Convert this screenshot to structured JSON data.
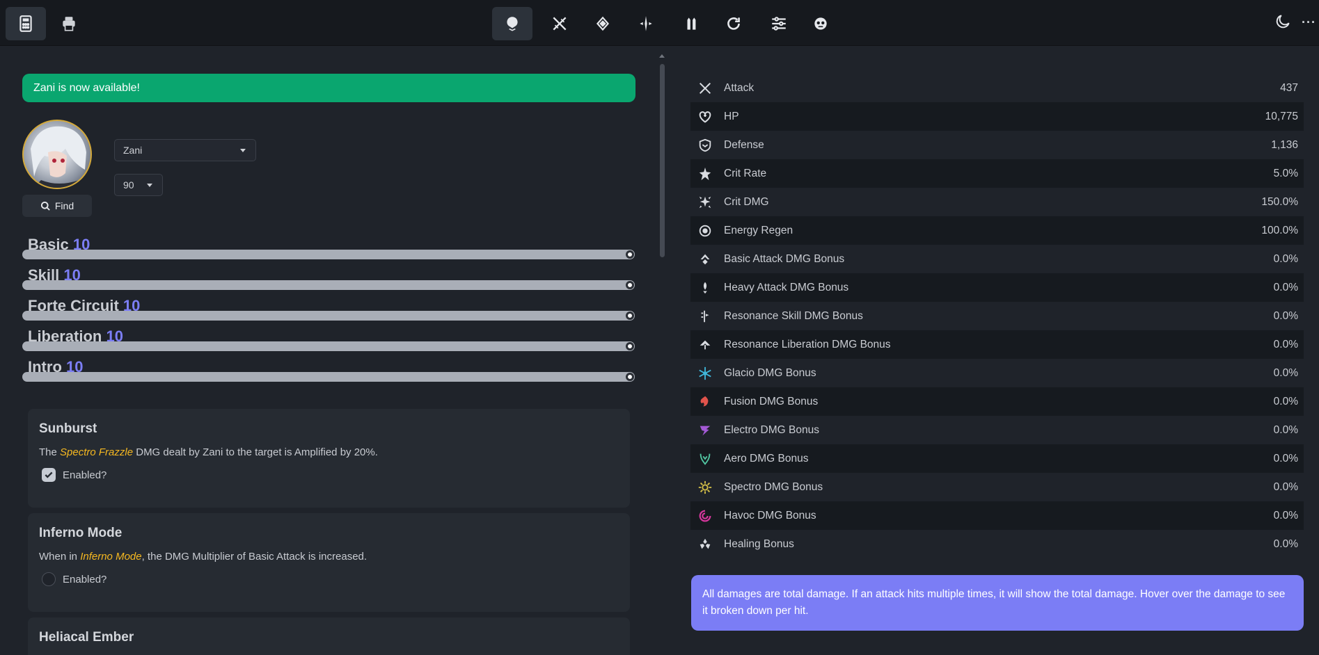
{
  "topbar": {
    "left_icons": [
      "calculator-icon",
      "printer-icon"
    ],
    "nav_icons": [
      "character-icon",
      "weapon-icon",
      "echo-icon",
      "sequence-icon",
      "team-icon",
      "rotation-icon",
      "settings-icon",
      "enemy-icon"
    ],
    "active_nav": "character-icon",
    "right_icons": [
      "moon-icon",
      "more-icon"
    ],
    "more_label": "···"
  },
  "banner": {
    "text": "Zani is now available!",
    "color": "#0aa66f"
  },
  "character": {
    "name": "Zani",
    "level": "90",
    "find_label": "Find"
  },
  "skills": [
    {
      "label": "Basic",
      "value": "10"
    },
    {
      "label": "Skill",
      "value": "10"
    },
    {
      "label": "Forte Circuit",
      "value": "10"
    },
    {
      "label": "Liberation",
      "value": "10"
    },
    {
      "label": "Intro",
      "value": "10"
    }
  ],
  "effects": [
    {
      "title": "Sunburst",
      "desc_pre": "The ",
      "desc_hl": "Spectro Frazzle",
      "desc_post": " DMG dealt by Zani to the target is Amplified by 20%.",
      "enabled_label": "Enabled?",
      "enabled": true
    },
    {
      "title": "Inferno Mode",
      "desc_pre": "When in ",
      "desc_hl": "Inferno Mode",
      "desc_post": ", the DMG Multiplier of Basic Attack is increased.",
      "enabled_label": "Enabled?",
      "enabled": false
    },
    {
      "title": "Heliacal Ember"
    }
  ],
  "stats": [
    {
      "name": "Attack",
      "value": "437",
      "icon": "attack-icon",
      "color": "#d9dce1"
    },
    {
      "name": "HP",
      "value": "10,775",
      "icon": "hp-icon",
      "color": "#d9dce1"
    },
    {
      "name": "Defense",
      "value": "1,136",
      "icon": "defense-icon",
      "color": "#d9dce1"
    },
    {
      "name": "Crit Rate",
      "value": "5.0%",
      "icon": "crit-rate-icon",
      "color": "#d9dce1"
    },
    {
      "name": "Crit DMG",
      "value": "150.0%",
      "icon": "crit-dmg-icon",
      "color": "#d9dce1"
    },
    {
      "name": "Energy Regen",
      "value": "100.0%",
      "icon": "energy-regen-icon",
      "color": "#d9dce1"
    },
    {
      "name": "Basic Attack DMG Bonus",
      "value": "0.0%",
      "icon": "basic-attack-icon",
      "color": "#d9dce1"
    },
    {
      "name": "Heavy Attack DMG Bonus",
      "value": "0.0%",
      "icon": "heavy-attack-icon",
      "color": "#d9dce1"
    },
    {
      "name": "Resonance Skill DMG Bonus",
      "value": "0.0%",
      "icon": "resonance-skill-icon",
      "color": "#d9dce1"
    },
    {
      "name": "Resonance Liberation DMG Bonus",
      "value": "0.0%",
      "icon": "resonance-liberation-icon",
      "color": "#d9dce1"
    },
    {
      "name": "Glacio DMG Bonus",
      "value": "0.0%",
      "icon": "glacio-icon",
      "color": "#3fb6d9"
    },
    {
      "name": "Fusion DMG Bonus",
      "value": "0.0%",
      "icon": "fusion-icon",
      "color": "#e0534b"
    },
    {
      "name": "Electro DMG Bonus",
      "value": "0.0%",
      "icon": "electro-icon",
      "color": "#a45ad6"
    },
    {
      "name": "Aero DMG Bonus",
      "value": "0.0%",
      "icon": "aero-icon",
      "color": "#52c9a4"
    },
    {
      "name": "Spectro DMG Bonus",
      "value": "0.0%",
      "icon": "spectro-icon",
      "color": "#d6c148"
    },
    {
      "name": "Havoc DMG Bonus",
      "value": "0.0%",
      "icon": "havoc-icon",
      "color": "#d8379e"
    },
    {
      "name": "Healing Bonus",
      "value": "0.0%",
      "icon": "healing-icon",
      "color": "#d9dce1"
    }
  ],
  "info": {
    "text": "All damages are total damage. If an attack hits multiple times, it will show the total damage. Hover over the damage to see it broken down per hit.",
    "color": "#7b7df5"
  }
}
